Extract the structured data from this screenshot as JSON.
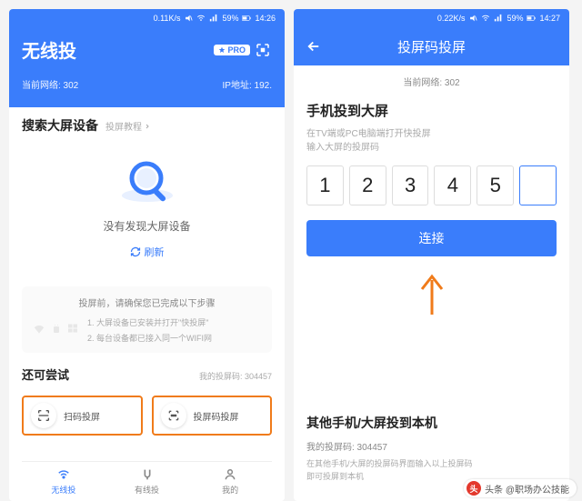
{
  "left": {
    "statusbar": {
      "speed": "0.11K/s",
      "battery": "59%",
      "time": "14:26"
    },
    "title": "无线投",
    "pro_label": "PRO",
    "network_label": "当前网络: 302",
    "ip_label": "IP地址: 192.",
    "search_title": "搜索大屏设备",
    "tutorial_label": "投屏教程",
    "not_found": "没有发现大屏设备",
    "refresh_label": "刷新",
    "steps_title": "投屏前，请确保您已完成以下步骤",
    "step1": "1. 大屏设备已安装并打开\"快投屏\"",
    "step2": "2. 每台设备都已接入同一个WIFI网",
    "try_title": "还可尝试",
    "my_code_label": "我的投屏码: 304457",
    "chip_scan": "扫码投屏",
    "chip_code": "投屏码投屏",
    "nav": {
      "wireless": "无线投",
      "wired": "有线投",
      "mine": "我的"
    }
  },
  "right": {
    "statusbar": {
      "speed": "0.22K/s",
      "battery": "59%",
      "time": "14:27"
    },
    "header_title": "投屏码投屏",
    "network_sub": "当前网络: 302",
    "cast_title": "手机投到大屏",
    "hint1": "在TV端或PC电脑端打开快投屏",
    "hint2": "输入大屏的投屏码",
    "code": [
      "1",
      "2",
      "3",
      "4",
      "5",
      ""
    ],
    "connect_label": "连接",
    "other_title": "其他手机/大屏投到本机",
    "other_code": "我的投屏码: 304457",
    "other_hint1": "在其他手机/大屏的投屏码界面输入以上投屏码",
    "other_hint2": "即可投屏到本机"
  },
  "watermark": "头条 @职场办公技能"
}
